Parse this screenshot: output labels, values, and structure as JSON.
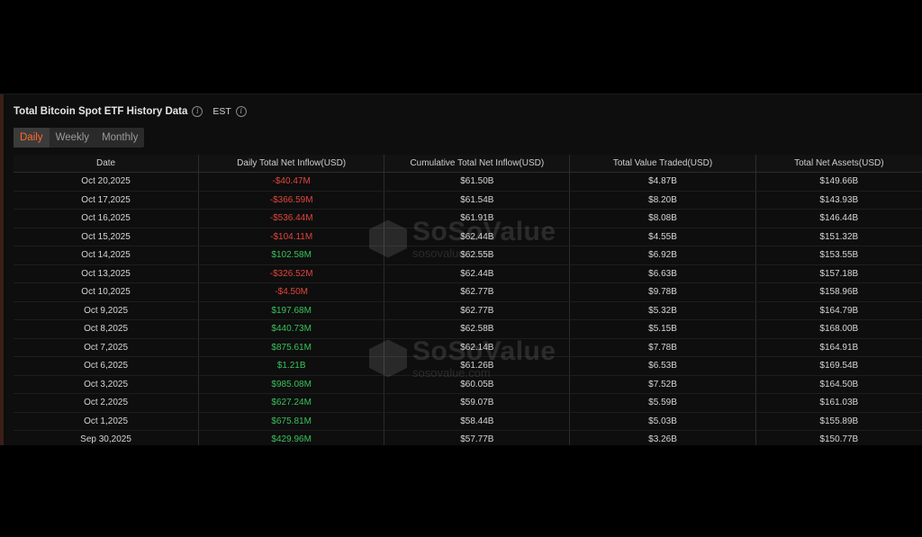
{
  "header": {
    "title": "Total Bitcoin Spot ETF History Data",
    "timezone": "EST"
  },
  "tabs": [
    {
      "label": "Daily",
      "active": true
    },
    {
      "label": "Weekly",
      "active": false
    },
    {
      "label": "Monthly",
      "active": false
    }
  ],
  "table": {
    "columns": [
      "Date",
      "Daily Total Net Inflow(USD)",
      "Cumulative Total Net Inflow(USD)",
      "Total Value Traded(USD)",
      "Total Net Assets(USD)"
    ],
    "rows": [
      {
        "date": "Oct 20,2025",
        "daily": "-$40.47M",
        "cumulative": "$61.50B",
        "traded": "$4.87B",
        "assets": "$149.66B",
        "sign": "neg"
      },
      {
        "date": "Oct 17,2025",
        "daily": "-$366.59M",
        "cumulative": "$61.54B",
        "traded": "$8.20B",
        "assets": "$143.93B",
        "sign": "neg"
      },
      {
        "date": "Oct 16,2025",
        "daily": "-$536.44M",
        "cumulative": "$61.91B",
        "traded": "$8.08B",
        "assets": "$146.44B",
        "sign": "neg"
      },
      {
        "date": "Oct 15,2025",
        "daily": "-$104.11M",
        "cumulative": "$62.44B",
        "traded": "$4.55B",
        "assets": "$151.32B",
        "sign": "neg"
      },
      {
        "date": "Oct 14,2025",
        "daily": "$102.58M",
        "cumulative": "$62.55B",
        "traded": "$6.92B",
        "assets": "$153.55B",
        "sign": "pos"
      },
      {
        "date": "Oct 13,2025",
        "daily": "-$326.52M",
        "cumulative": "$62.44B",
        "traded": "$6.63B",
        "assets": "$157.18B",
        "sign": "neg"
      },
      {
        "date": "Oct 10,2025",
        "daily": "-$4.50M",
        "cumulative": "$62.77B",
        "traded": "$9.78B",
        "assets": "$158.96B",
        "sign": "neg"
      },
      {
        "date": "Oct 9,2025",
        "daily": "$197.68M",
        "cumulative": "$62.77B",
        "traded": "$5.32B",
        "assets": "$164.79B",
        "sign": "pos"
      },
      {
        "date": "Oct 8,2025",
        "daily": "$440.73M",
        "cumulative": "$62.58B",
        "traded": "$5.15B",
        "assets": "$168.00B",
        "sign": "pos"
      },
      {
        "date": "Oct 7,2025",
        "daily": "$875.61M",
        "cumulative": "$62.14B",
        "traded": "$7.78B",
        "assets": "$164.91B",
        "sign": "pos"
      },
      {
        "date": "Oct 6,2025",
        "daily": "$1.21B",
        "cumulative": "$61.26B",
        "traded": "$6.53B",
        "assets": "$169.54B",
        "sign": "pos"
      },
      {
        "date": "Oct 3,2025",
        "daily": "$985.08M",
        "cumulative": "$60.05B",
        "traded": "$7.52B",
        "assets": "$164.50B",
        "sign": "pos"
      },
      {
        "date": "Oct 2,2025",
        "daily": "$627.24M",
        "cumulative": "$59.07B",
        "traded": "$5.59B",
        "assets": "$161.03B",
        "sign": "pos"
      },
      {
        "date": "Oct 1,2025",
        "daily": "$675.81M",
        "cumulative": "$58.44B",
        "traded": "$5.03B",
        "assets": "$155.89B",
        "sign": "pos"
      },
      {
        "date": "Sep 30,2025",
        "daily": "$429.96M",
        "cumulative": "$57.77B",
        "traded": "$3.26B",
        "assets": "$150.77B",
        "sign": "pos"
      }
    ]
  },
  "watermark": {
    "brand": "SoSoValue",
    "url": "sosovalue.com"
  },
  "colors": {
    "negative": "#e0453d",
    "positive": "#38c25c",
    "active_tab": "#ff6a2a"
  }
}
